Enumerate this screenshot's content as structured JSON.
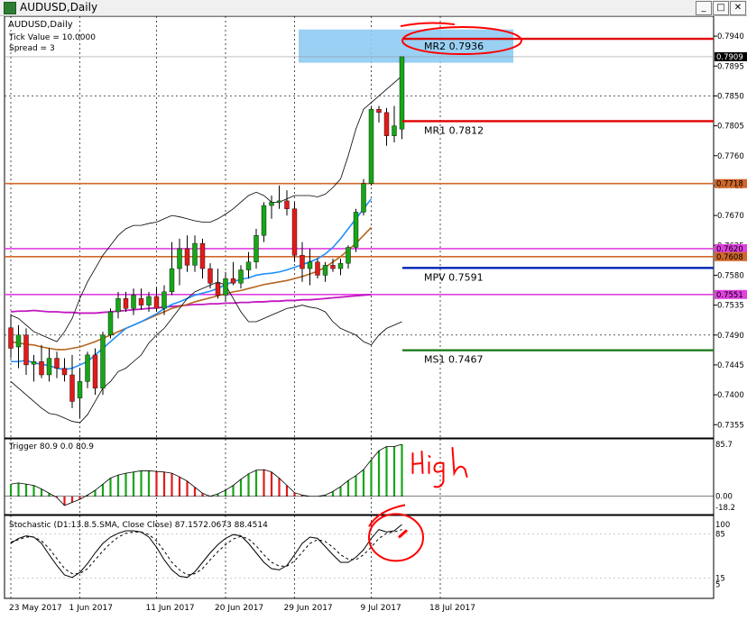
{
  "window": {
    "title": "AUDUSD,Daily",
    "controls": {
      "minimize": "_",
      "maximize": "□",
      "close": "✕"
    }
  },
  "colors": {
    "bull": "#18a518",
    "bear": "#e11b1b",
    "mr2": "#e00000",
    "mr1": "#e00000",
    "mpv": "#0022b5",
    "ms1": "#1f7d1f",
    "orange": "#d0672a",
    "magenta": "#e040e0",
    "bb": "#000000",
    "ma_blue": "#1e90ff",
    "ma_brown": "#b5651d",
    "ma_purple": "#c218c2",
    "rect": "#8ecbf2",
    "annot": "#ff0000"
  },
  "chart_data": [
    {
      "type": "candlestick",
      "symbol_label": "AUDUSD,Daily",
      "info_lines": [
        "Tick Value = 10.0000",
        "Spread = 3"
      ],
      "ylim": [
        0.7335,
        0.797
      ],
      "price_ticks": [
        "0.7940",
        "0.7895",
        "0.7850",
        "0.7805",
        "0.7760",
        "0.7715",
        "0.7670",
        "0.7625",
        "0.7580",
        "0.7535",
        "0.7490",
        "0.7445",
        "0.7400",
        "0.7355"
      ],
      "price_tick_values": [
        0.794,
        0.7895,
        0.785,
        0.7805,
        0.776,
        0.7715,
        0.767,
        0.7625,
        0.758,
        0.7535,
        0.749,
        0.7445,
        0.74,
        0.7355
      ],
      "x_labels": [
        "23 May 2017",
        "1 Jun 2017",
        "11 Jun 2017",
        "20 Jun 2017",
        "29 Jun 2017",
        "9 Jul 2017",
        "18 Jul 2017"
      ],
      "x_label_index": [
        0,
        9,
        19,
        28,
        37,
        47,
        56
      ],
      "candles": [
        [
          0.7501,
          0.752,
          0.7455,
          0.747
        ],
        [
          0.7472,
          0.7505,
          0.744,
          0.749
        ],
        [
          0.749,
          0.75,
          0.743,
          0.7445
        ],
        [
          0.7446,
          0.746,
          0.742,
          0.745
        ],
        [
          0.745,
          0.7475,
          0.7425,
          0.743
        ],
        [
          0.743,
          0.747,
          0.742,
          0.7455
        ],
        [
          0.7455,
          0.7465,
          0.7425,
          0.744
        ],
        [
          0.744,
          0.7455,
          0.742,
          0.743
        ],
        [
          0.743,
          0.746,
          0.738,
          0.739
        ],
        [
          0.7395,
          0.744,
          0.7365,
          0.742
        ],
        [
          0.742,
          0.7465,
          0.741,
          0.746
        ],
        [
          0.746,
          0.747,
          0.74,
          0.741
        ],
        [
          0.741,
          0.7495,
          0.74,
          0.749
        ],
        [
          0.749,
          0.753,
          0.7485,
          0.7525
        ],
        [
          0.7525,
          0.7555,
          0.7515,
          0.7545
        ],
        [
          0.7545,
          0.7555,
          0.7525,
          0.753
        ],
        [
          0.753,
          0.756,
          0.752,
          0.755
        ],
        [
          0.7545,
          0.756,
          0.7528,
          0.7535
        ],
        [
          0.7535,
          0.7555,
          0.7525,
          0.7548
        ],
        [
          0.7548,
          0.7562,
          0.7525,
          0.753
        ],
        [
          0.753,
          0.7565,
          0.752,
          0.7555
        ],
        [
          0.7555,
          0.763,
          0.755,
          0.759
        ],
        [
          0.759,
          0.7635,
          0.7565,
          0.762
        ],
        [
          0.762,
          0.764,
          0.7585,
          0.7595
        ],
        [
          0.7595,
          0.764,
          0.7585,
          0.7628
        ],
        [
          0.7628,
          0.7635,
          0.7575,
          0.759
        ],
        [
          0.759,
          0.7598,
          0.756,
          0.7568
        ],
        [
          0.7568,
          0.759,
          0.7545,
          0.755
        ],
        [
          0.755,
          0.7585,
          0.754,
          0.7575
        ],
        [
          0.7575,
          0.76,
          0.7565,
          0.7568
        ],
        [
          0.7568,
          0.7595,
          0.756,
          0.7588
        ],
        [
          0.7588,
          0.7615,
          0.7575,
          0.76
        ],
        [
          0.76,
          0.765,
          0.759,
          0.764
        ],
        [
          0.764,
          0.769,
          0.763,
          0.7685
        ],
        [
          0.7685,
          0.77,
          0.7665,
          0.769
        ],
        [
          0.769,
          0.7715,
          0.768,
          0.7692
        ],
        [
          0.7692,
          0.7708,
          0.767,
          0.768
        ],
        [
          0.768,
          0.769,
          0.76,
          0.761
        ],
        [
          0.761,
          0.763,
          0.757,
          0.759
        ],
        [
          0.759,
          0.762,
          0.7565,
          0.76
        ],
        [
          0.76,
          0.7605,
          0.7575,
          0.758
        ],
        [
          0.758,
          0.76,
          0.757,
          0.7595
        ],
        [
          0.7595,
          0.7605,
          0.7585,
          0.759
        ],
        [
          0.759,
          0.7605,
          0.758,
          0.7598
        ],
        [
          0.7598,
          0.7625,
          0.759,
          0.7622
        ],
        [
          0.7622,
          0.768,
          0.7615,
          0.7675
        ],
        [
          0.7675,
          0.7725,
          0.767,
          0.7718
        ],
        [
          0.7718,
          0.7835,
          0.7715,
          0.783
        ],
        [
          0.783,
          0.7835,
          0.781,
          0.7825
        ],
        [
          0.7825,
          0.7832,
          0.7775,
          0.779
        ],
        [
          0.779,
          0.7835,
          0.778,
          0.7805
        ],
        [
          0.78,
          0.7909,
          0.7785,
          0.7909
        ]
      ],
      "candle_slots": [
        0,
        1,
        2,
        3,
        4,
        5,
        6,
        7,
        8,
        9,
        10,
        11,
        12,
        13,
        14,
        15,
        16,
        17,
        18,
        19,
        20,
        21,
        22,
        23,
        24,
        25,
        26,
        27,
        28,
        29,
        30,
        31,
        32,
        33,
        34,
        35,
        36,
        37,
        38,
        39,
        40,
        41,
        42,
        43,
        44,
        45,
        46,
        47,
        48,
        49,
        50,
        51
      ],
      "total_slots": 92,
      "levels": [
        {
          "name": "MR2",
          "value": 0.7936,
          "label": "MR2   0.7936",
          "color": "#e00000",
          "from_slot": 52
        },
        {
          "name": "MR1",
          "value": 0.7812,
          "label": "MR1   0.7812",
          "color": "#e00000",
          "from_slot": 52
        },
        {
          "name": "MPV",
          "value": 0.7591,
          "label": "MPV   0.7591",
          "color": "#0022b5",
          "from_slot": 52
        },
        {
          "name": "MS1",
          "value": 0.7467,
          "label": "MS1   0.7467",
          "color": "#1f7d1f",
          "from_slot": 52
        }
      ],
      "hlines": [
        {
          "value": 0.7718,
          "color": "#d0672a",
          "tag": "0.7718"
        },
        {
          "value": 0.762,
          "color": "#e040e0",
          "tag": "0.7620"
        },
        {
          "value": 0.7608,
          "color": "#d0672a",
          "tag": "0.7608"
        },
        {
          "value": 0.7551,
          "color": "#e040e0",
          "tag": "0.7551"
        }
      ],
      "current_price": {
        "value": 0.7909,
        "tag": "0.7909"
      },
      "rect_zone": {
        "from_slot": 38,
        "to_slot": 66,
        "y0": 0.795,
        "y1": 0.79
      },
      "bb_upper": [
        0.752,
        0.7515,
        0.7505,
        0.7495,
        0.749,
        0.7485,
        0.748,
        0.7495,
        0.7515,
        0.7545,
        0.757,
        0.759,
        0.761,
        0.7625,
        0.764,
        0.765,
        0.7655,
        0.7655,
        0.7658,
        0.766,
        0.7665,
        0.767,
        0.7668,
        0.7665,
        0.7662,
        0.766,
        0.766,
        0.7665,
        0.7672,
        0.768,
        0.769,
        0.77,
        0.7705,
        0.77,
        0.769,
        0.769,
        0.7695,
        0.77,
        0.77,
        0.77,
        0.7698,
        0.7702,
        0.7712,
        0.7725,
        0.776,
        0.78,
        0.783,
        0.784,
        0.785,
        0.786,
        0.787,
        0.788
      ],
      "bb_lower": [
        0.742,
        0.741,
        0.74,
        0.739,
        0.738,
        0.7372,
        0.737,
        0.7365,
        0.736,
        0.7358,
        0.737,
        0.739,
        0.741,
        0.742,
        0.7435,
        0.744,
        0.745,
        0.746,
        0.7478,
        0.749,
        0.75,
        0.7515,
        0.753,
        0.7545,
        0.7555,
        0.756,
        0.7565,
        0.757,
        0.7565,
        0.7545,
        0.7525,
        0.751,
        0.751,
        0.7515,
        0.752,
        0.7525,
        0.753,
        0.7532,
        0.7535,
        0.7532,
        0.753,
        0.7525,
        0.751,
        0.75,
        0.7495,
        0.749,
        0.748,
        0.7475,
        0.749,
        0.75,
        0.7505,
        0.751
      ],
      "ma_blue": [
        0.745,
        0.745,
        0.7452,
        0.7448,
        0.7446,
        0.7444,
        0.744,
        0.7438,
        0.744,
        0.7445,
        0.745,
        0.746,
        0.747,
        0.748,
        0.749,
        0.75,
        0.7505,
        0.751,
        0.7516,
        0.7522,
        0.753,
        0.7536,
        0.754,
        0.7545,
        0.755,
        0.7553,
        0.7556,
        0.756,
        0.7566,
        0.757,
        0.7574,
        0.7576,
        0.758,
        0.7582,
        0.7583,
        0.7585,
        0.7588,
        0.7592,
        0.7596,
        0.76,
        0.7605,
        0.7612,
        0.7622,
        0.7635,
        0.765,
        0.7665,
        0.768,
        0.7695
      ],
      "ma_brown": [
        0.748,
        0.7478,
        0.7476,
        0.7475,
        0.7472,
        0.747,
        0.7468,
        0.7468,
        0.747,
        0.7472,
        0.7476,
        0.748,
        0.7485,
        0.749,
        0.7495,
        0.75,
        0.7505,
        0.751,
        0.7515,
        0.752,
        0.7525,
        0.753,
        0.7533,
        0.7536,
        0.754,
        0.7543,
        0.7546,
        0.7549,
        0.7552,
        0.7555,
        0.7557,
        0.756,
        0.7563,
        0.7566,
        0.7568,
        0.757,
        0.7572,
        0.7575,
        0.7578,
        0.7582,
        0.7586,
        0.7592,
        0.76,
        0.7608,
        0.7618,
        0.7628,
        0.764,
        0.7652
      ],
      "ma_purple": [
        0.7525,
        0.7526,
        0.7526,
        0.7527,
        0.7526,
        0.7525,
        0.7525,
        0.7524,
        0.7524,
        0.7523,
        0.7523,
        0.7523,
        0.7524,
        0.7525,
        0.7526,
        0.7527,
        0.7528,
        0.7529,
        0.753,
        0.7531,
        0.7532,
        0.7533,
        0.7534,
        0.7535,
        0.7536,
        0.7536,
        0.7537,
        0.7537,
        0.7538,
        0.7538,
        0.7539,
        0.7539,
        0.754,
        0.754,
        0.7541,
        0.7541,
        0.7542,
        0.7542,
        0.7543,
        0.7543,
        0.7544,
        0.7545,
        0.7546,
        0.7547,
        0.7548,
        0.7549,
        0.755,
        0.7551
      ]
    },
    {
      "type": "histogram",
      "label": "Trigger 80.9 0.0 80.9",
      "ylim": [
        -18.2,
        85.7
      ],
      "ticks": [
        "85.7",
        "0.00",
        "-18.2"
      ],
      "tick_values": [
        85.7,
        0.0,
        -18.2
      ],
      "bars": [
        20,
        22,
        20,
        18,
        12,
        5,
        -2,
        -15,
        -10,
        -5,
        2,
        10,
        20,
        30,
        35,
        38,
        40,
        42,
        42,
        41,
        40,
        38,
        32,
        25,
        15,
        5,
        0,
        4,
        10,
        18,
        28,
        37,
        43,
        44,
        40,
        30,
        18,
        6,
        2,
        0,
        0,
        2,
        8,
        16,
        26,
        34,
        44,
        60,
        75,
        82,
        82,
        85.7
      ],
      "bar_colors": [
        "g",
        "g",
        "g",
        "g",
        "g",
        "g",
        "r",
        "r",
        "r",
        "r",
        "g",
        "g",
        "g",
        "g",
        "g",
        "g",
        "g",
        "g",
        "g",
        "r",
        "r",
        "r",
        "r",
        "r",
        "r",
        "r",
        "g",
        "g",
        "g",
        "g",
        "g",
        "g",
        "g",
        "r",
        "r",
        "r",
        "r",
        "r",
        "r",
        "g",
        "g",
        "g",
        "g",
        "g",
        "g",
        "g",
        "g",
        "g",
        "g",
        "g",
        "g",
        "g"
      ],
      "annotation": "High"
    },
    {
      "type": "line",
      "label": "Stochastic (D1:13.8.5.SMA, Close Close) 87.1572.0673 88.4514",
      "ylim": [
        0,
        100
      ],
      "ticks": [
        "100",
        "85",
        "15",
        "5"
      ],
      "tick_values": [
        100,
        85,
        15,
        5
      ],
      "main": [
        70,
        78,
        82,
        80,
        70,
        52,
        35,
        20,
        16,
        24,
        38,
        55,
        70,
        80,
        86,
        90,
        90,
        88,
        80,
        64,
        44,
        28,
        18,
        16,
        25,
        40,
        55,
        68,
        78,
        84,
        82,
        70,
        55,
        40,
        30,
        28,
        35,
        52,
        70,
        80,
        78,
        65,
        52,
        40,
        40,
        48,
        60,
        78,
        92,
        88,
        90,
        100
      ],
      "signal": [
        72,
        76,
        80,
        80,
        74,
        62,
        46,
        30,
        22,
        22,
        30,
        44,
        58,
        70,
        80,
        86,
        88,
        88,
        84,
        74,
        58,
        40,
        28,
        20,
        22,
        30,
        44,
        57,
        68,
        77,
        81,
        77,
        66,
        52,
        40,
        34,
        34,
        42,
        56,
        70,
        76,
        73,
        64,
        52,
        45,
        44,
        52,
        64,
        78,
        86,
        88,
        92
      ]
    }
  ]
}
